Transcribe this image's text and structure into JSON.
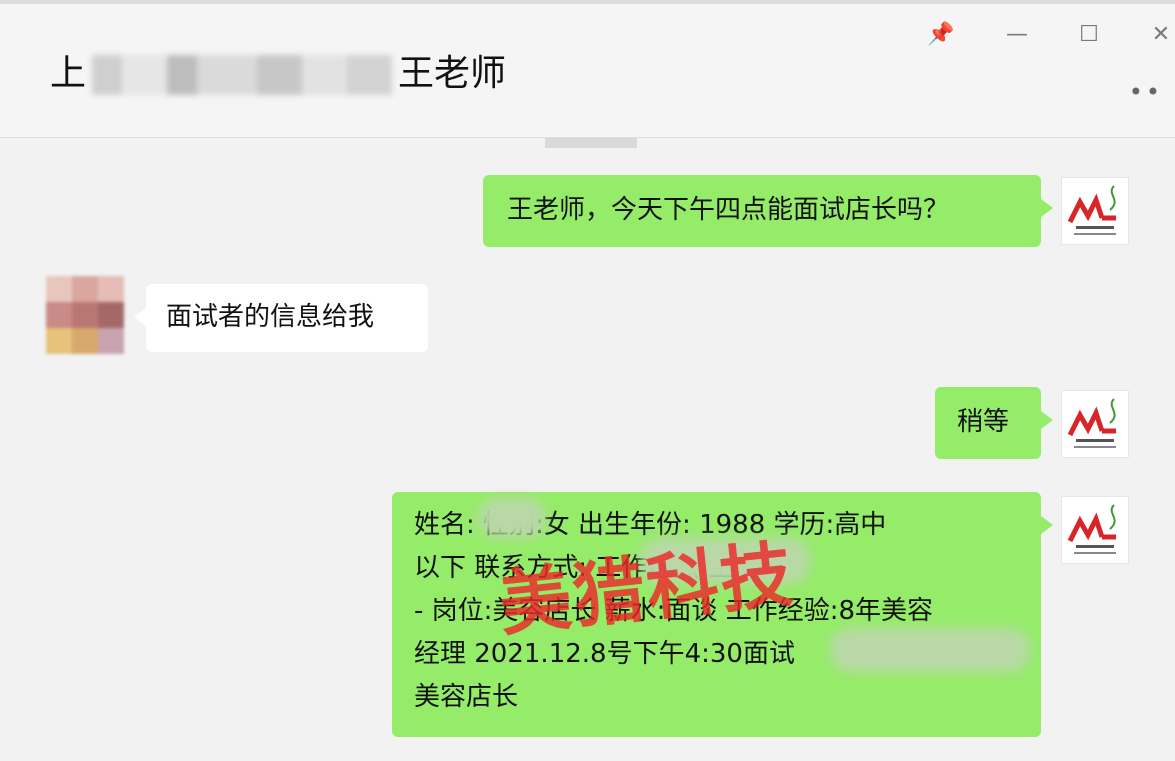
{
  "header": {
    "title_prefix": "上",
    "title_suffix": "王老师",
    "more_label": "••"
  },
  "window_controls": {
    "pin": "📌",
    "minimize": "—",
    "maximize": "☐",
    "close": "✕"
  },
  "messages": [
    {
      "sender": "me",
      "text": "王老师，今天下午四点能面试店长吗？"
    },
    {
      "sender": "other",
      "text": "面试者的信息给我"
    },
    {
      "sender": "me",
      "text": "稍等"
    },
    {
      "sender": "me",
      "lines": [
        "姓名: 性别:女 出生年份: 1988 学历:高中",
        "以下 联系方式: 工作地点:上海-",
        "- 岗位:美容店长 薪水:面谈 工作经验:8年美容",
        "经理 2021.12.8号下午4:30面试",
        "美容店长"
      ]
    }
  ],
  "watermark": "美猎科技",
  "colors": {
    "my_bubble": "#95ec69",
    "other_bubble": "#ffffff",
    "background": "#f2f2f2",
    "logo_red": "#d8252a",
    "logo_green": "#3a9a3a"
  },
  "icons": {
    "pin": "pin-icon",
    "minimize": "minimize-icon",
    "maximize": "maximize-icon",
    "close": "close-icon",
    "more": "more-icon"
  }
}
